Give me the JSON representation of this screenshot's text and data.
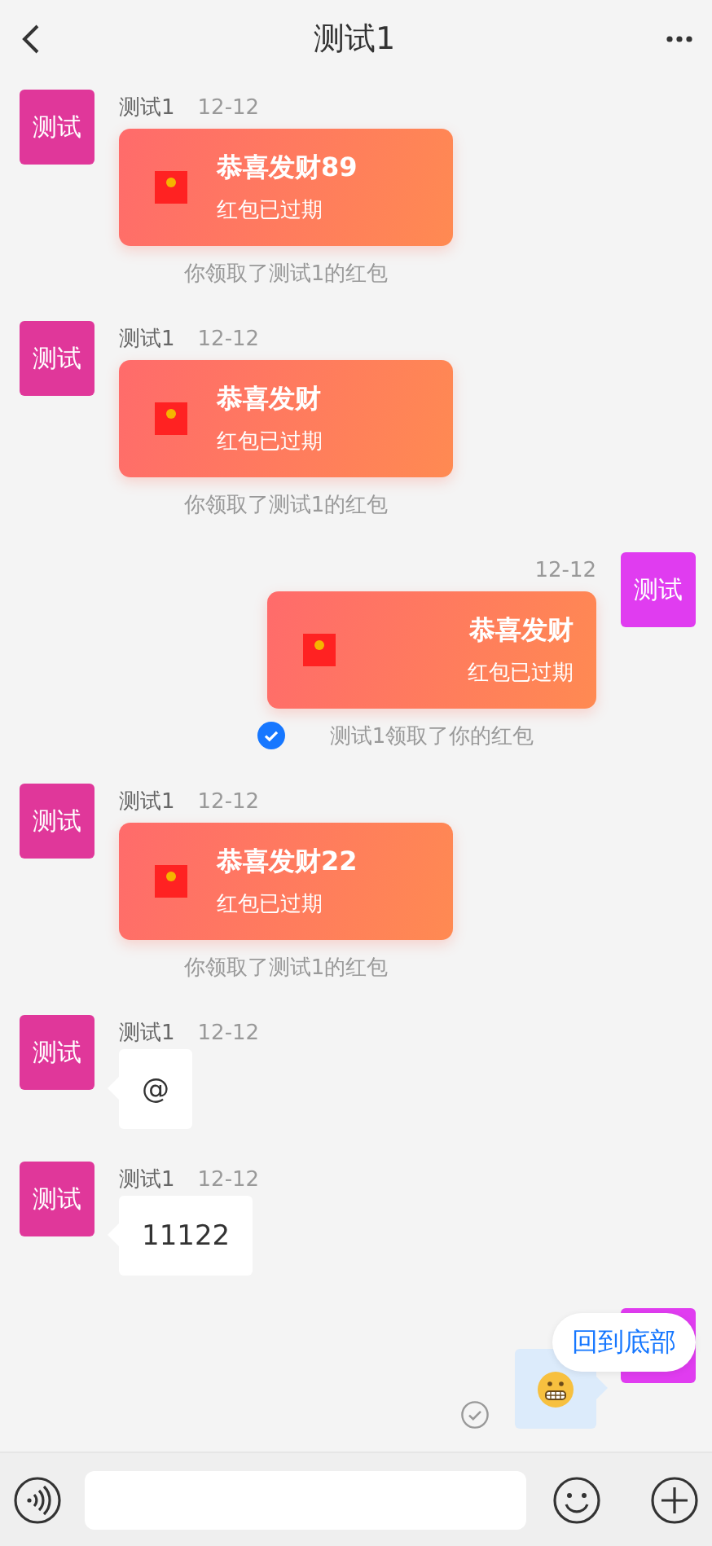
{
  "header": {
    "title": "测试1"
  },
  "messages": [
    {
      "kind": "red_packet",
      "outgoing": false,
      "avatar": {
        "label": "测试",
        "color": "#e0379a"
      },
      "sender": "测试1",
      "time": "12-12",
      "title": "恭喜发财89",
      "status": "红包已过期",
      "note": "你领取了测试1的红包"
    },
    {
      "kind": "red_packet",
      "outgoing": false,
      "avatar": {
        "label": "测试",
        "color": "#e0379a"
      },
      "sender": "测试1",
      "time": "12-12",
      "title": "恭喜发财",
      "status": "红包已过期",
      "note": "你领取了测试1的红包"
    },
    {
      "kind": "red_packet",
      "outgoing": true,
      "avatar": {
        "label": "测试",
        "color": "#e03cf0"
      },
      "time": "12-12",
      "title": "恭喜发财",
      "status": "红包已过期",
      "note": "测试1领取了你的红包",
      "read": true
    },
    {
      "kind": "red_packet",
      "outgoing": false,
      "avatar": {
        "label": "测试",
        "color": "#e0379a"
      },
      "sender": "测试1",
      "time": "12-12",
      "title": "恭喜发财22",
      "status": "红包已过期",
      "note": "你领取了测试1的红包"
    },
    {
      "kind": "text",
      "outgoing": false,
      "avatar": {
        "label": "测试",
        "color": "#e0379a"
      },
      "sender": "测试1",
      "time": "12-12",
      "text": "@"
    },
    {
      "kind": "text",
      "outgoing": false,
      "avatar": {
        "label": "测试",
        "color": "#e0379a"
      },
      "sender": "测试1",
      "time": "12-12",
      "text": "11122"
    },
    {
      "kind": "emoji",
      "outgoing": true,
      "avatar": {
        "color": "#e03cf0"
      },
      "read": false
    }
  ],
  "scroll_to_bottom": "回到底部"
}
